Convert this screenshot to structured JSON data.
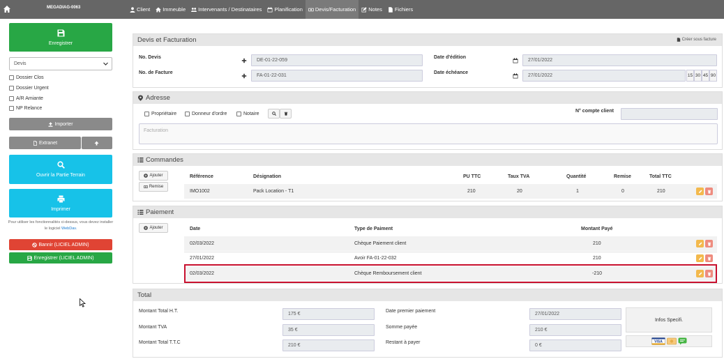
{
  "navbar": {
    "brand": "MEGADIAG-0063",
    "tabs": [
      {
        "label": "Client",
        "icon": "user-icon"
      },
      {
        "label": "Immeuble",
        "icon": "home-icon"
      },
      {
        "label": "Intervenants / Destinataires",
        "icon": "users-icon"
      },
      {
        "label": "Planification",
        "icon": "calendar-icon"
      },
      {
        "label": "Devis/Facturation",
        "icon": "money-icon",
        "active": true
      },
      {
        "label": "Notes",
        "icon": "edit-icon"
      },
      {
        "label": "Fichiers",
        "icon": "file-icon"
      }
    ]
  },
  "left": {
    "save_label": "Enregistrer",
    "select_value": "Devis",
    "checks": [
      "Dossier Clos",
      "Dossier Urgent",
      "A/R Amiante",
      "NP Relance"
    ],
    "import_label": "Importer",
    "extranet_label": "Extranet",
    "terrain_label": "Ouvrir la Partie Terrain",
    "print_label": "Imprimer",
    "note_text": "Pour utiliser les fonctionnalités ci-dessus, vous devez installer le logiciel",
    "note_link": "WebDav.",
    "ban_label": "Bannir (LICIEL ADMIN)",
    "save_admin_label": "Enregistrer (LICIEL ADMIN)"
  },
  "devis": {
    "title": "Devis et Facturation",
    "create_invoice": "Créer sous facture",
    "no_devis_label": "No. Devis",
    "no_devis_value": "DE-01-22-059",
    "no_facture_label": "No. de Facture",
    "no_facture_value": "FA-01-22-031",
    "date_edition_label": "Date d'édition",
    "date_edition_value": "27/01/2022",
    "date_echeance_label": "Date échéance",
    "date_echeance_value": "27/01/2022",
    "quick_days": [
      "15",
      "30",
      "45",
      "90"
    ]
  },
  "adresse": {
    "title": "Adresse",
    "options": [
      "Propriétaire",
      "Donneur d'ordre",
      "Notaire"
    ],
    "compte_label": "N° compte client",
    "compte_value": "",
    "textarea_placeholder": "Facturation"
  },
  "commandes": {
    "title": "Commandes",
    "add_label": "Ajouter",
    "remise_label": "Remise",
    "headers": [
      "Référence",
      "Désignation",
      "PU TTC",
      "Taux TVA",
      "Quantité",
      "Remise",
      "Total TTC"
    ],
    "rows": [
      [
        "IMO1002",
        "Pack Location - T1",
        "210",
        "20",
        "1",
        "0",
        "210"
      ]
    ]
  },
  "paiement": {
    "title": "Paiement",
    "add_label": "Ajouter",
    "headers": [
      "Date",
      "Type de Paiment",
      "Montant Payé"
    ],
    "rows": [
      [
        "02/03/2022",
        "Chèque Paiement client",
        "210"
      ],
      [
        "27/01/2022",
        "Avoir FA-01-22-032",
        "210"
      ],
      [
        "02/03/2022",
        "Chèque Remboursement client",
        "-210"
      ]
    ]
  },
  "total": {
    "title": "Total",
    "ht_label": "Montant Total H.T.",
    "ht_value": "175 €",
    "tva_label": "Montant TVA",
    "tva_value": "35 €",
    "ttc_label": "Montant Total T.T.C",
    "ttc_value": "210 €",
    "first_payment_label": "Date premier paiement",
    "first_payment_value": "27/01/2022",
    "paid_label": "Somme payée",
    "paid_value": "210 €",
    "remaining_label": "Restant à payer",
    "remaining_value": "0 €",
    "infos_label": "Infos Specifi.",
    "card_label": "VISA"
  }
}
